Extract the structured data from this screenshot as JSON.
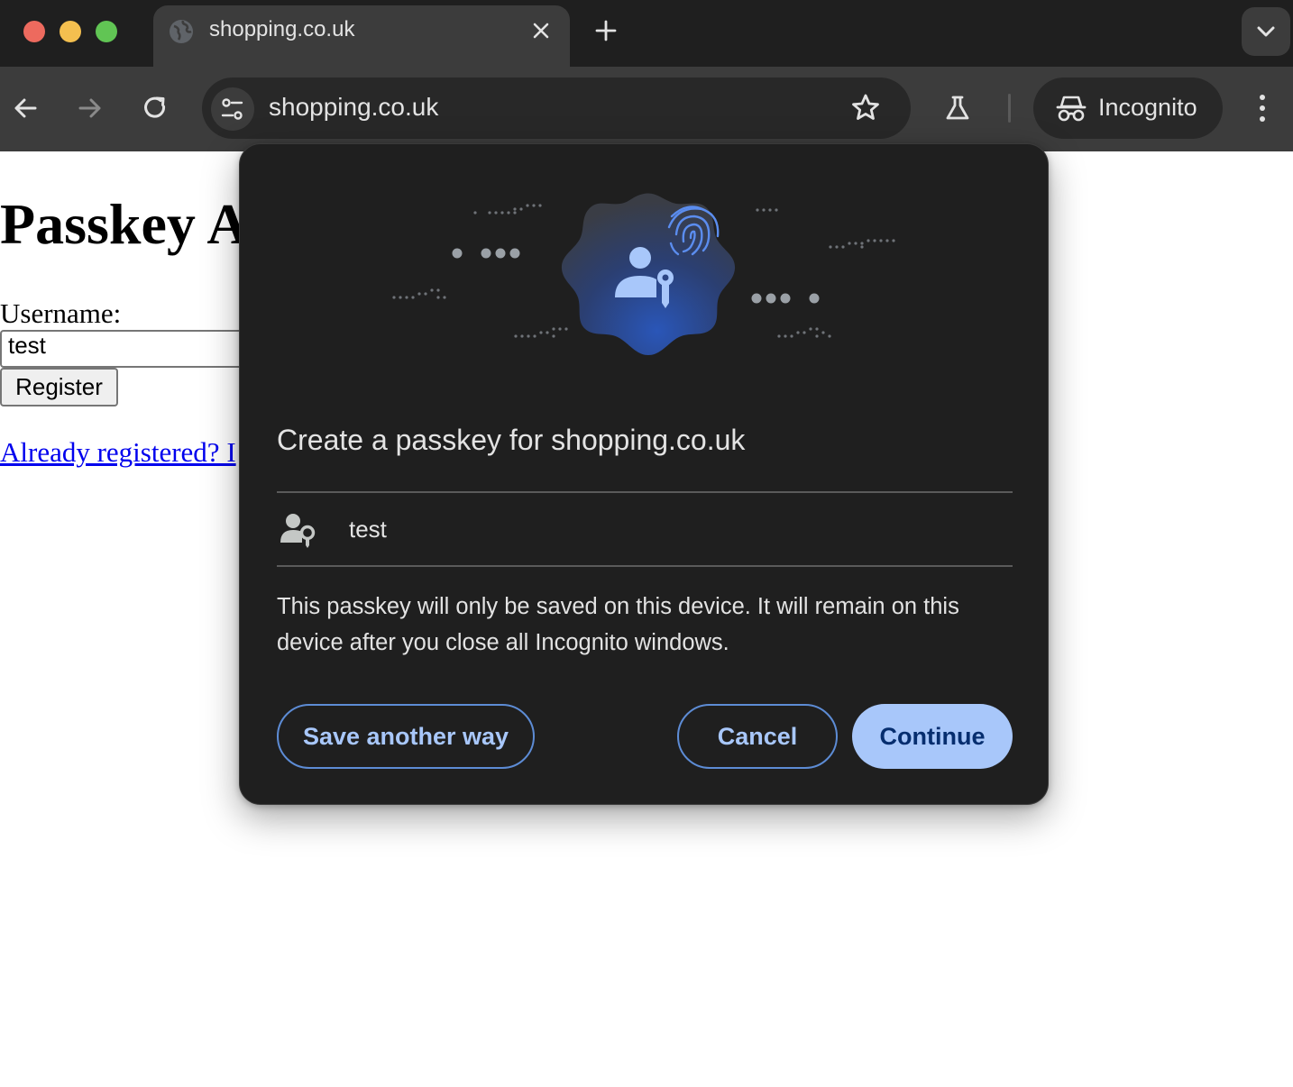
{
  "browser": {
    "tab": {
      "title": "shopping.co.uk",
      "favicon": "globe-icon"
    },
    "toolbar": {
      "url": "shopping.co.uk",
      "incognito_label": "Incognito"
    },
    "colors": {
      "chrome_dark": "#1f1f1f",
      "toolbar": "#3c3c3c",
      "accent": "#a8c7fa"
    }
  },
  "page": {
    "title": "Passkey A",
    "username_label": "Username:",
    "username_value": "test",
    "register_label": "Register",
    "already_link": "Already registered? I"
  },
  "dialog": {
    "title": "Create a passkey for shopping.co.uk",
    "account_name": "test",
    "description": "This passkey will only be saved on this device. It will remain on this device after you close all Incognito windows.",
    "buttons": {
      "save_another": "Save another way",
      "cancel": "Cancel",
      "continue": "Continue"
    }
  }
}
